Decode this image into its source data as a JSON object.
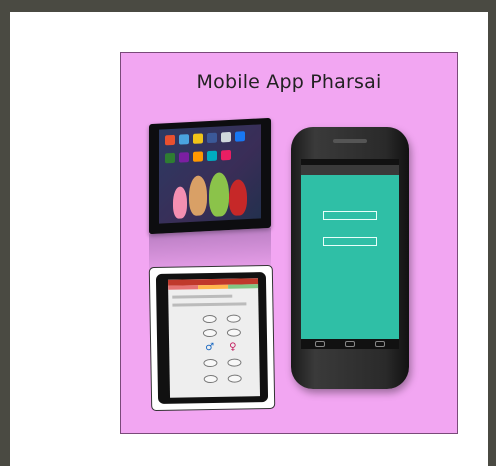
{
  "slide": {
    "title": "Mobile App Pharsai",
    "background_color": "#f2a6f2"
  },
  "images": {
    "tablet_photo": "tablet-home-screen-photo",
    "phone_photo": "android-phone-app-screen-photo",
    "form_photo": "app-form-screen-photo"
  },
  "icons": {
    "male": "♂",
    "female": "♀"
  }
}
